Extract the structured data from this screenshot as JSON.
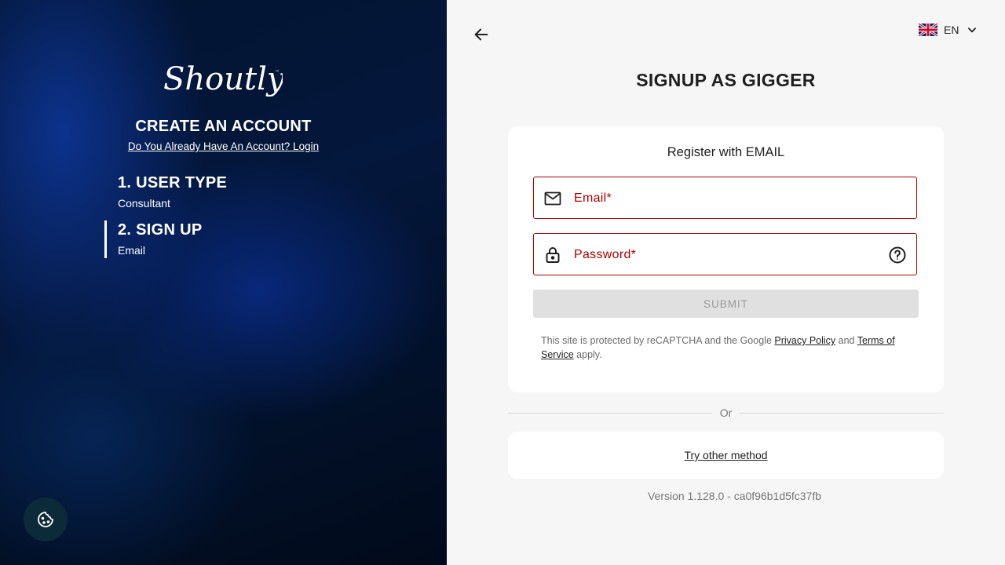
{
  "left_panel": {
    "logo_text": "Shoutly",
    "title": "CREATE AN ACCOUNT",
    "login_link": "Do You Already Have An Account? Login",
    "steps": [
      {
        "title": "1. USER TYPE",
        "sub": "Consultant",
        "active": false
      },
      {
        "title": "2. SIGN UP",
        "sub": "Email",
        "active": true
      }
    ],
    "cookie_icon": "cookie-icon"
  },
  "header": {
    "back_icon": "arrow-left-icon",
    "language": {
      "code": "EN",
      "flag": "uk-flag-icon"
    }
  },
  "page_title": "SIGNUP AS GIGGER",
  "form": {
    "title": "Register with EMAIL",
    "email_label": "Email*",
    "password_label": "Password*",
    "submit_label": "SUBMIT",
    "recaptcha": {
      "prefix": "This site is protected by reCAPTCHA and the Google ",
      "privacy": "Privacy Policy",
      "and": " and ",
      "terms": "Terms of Service",
      "suffix": " apply."
    }
  },
  "divider_text": "Or",
  "other_method": "Try other method",
  "version": "Version 1.128.0 - ca0f96b1d5fc37fb",
  "colors": {
    "error": "#b00000",
    "panel_dark": "#021430",
    "accent_blue": "#1040aa"
  }
}
